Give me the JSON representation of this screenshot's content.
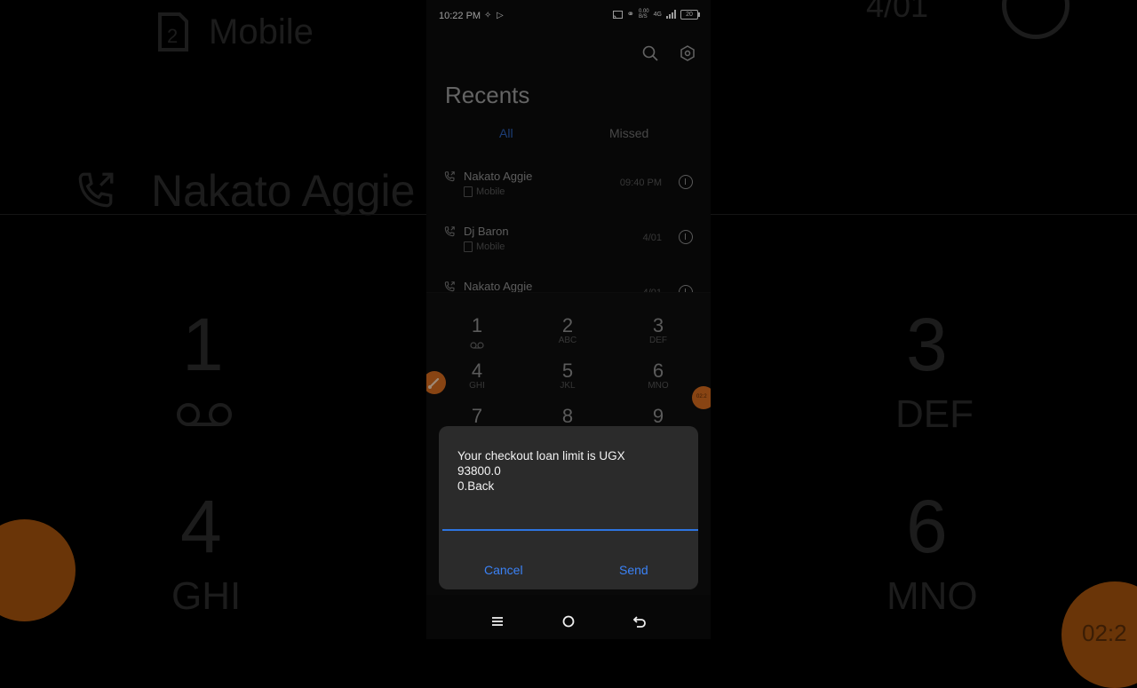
{
  "status_bar": {
    "time": "10:22 PM",
    "net_speed": "0.00",
    "net_unit": "B/S",
    "network": "4G",
    "battery": "20"
  },
  "app": {
    "title": "Recents"
  },
  "tabs": [
    {
      "label": "All",
      "active": true
    },
    {
      "label": "Missed",
      "active": false
    }
  ],
  "calls": [
    {
      "name": "Nakato Aggie",
      "line": "Mobile",
      "time": "09:40 PM"
    },
    {
      "name": "Dj Baron",
      "line": "Mobile",
      "time": "4/01"
    },
    {
      "name": "Nakato Aggie",
      "line": "",
      "time": "4/01"
    }
  ],
  "dialpad": [
    {
      "digit": "1",
      "letters": ""
    },
    {
      "digit": "2",
      "letters": "ABC"
    },
    {
      "digit": "3",
      "letters": "DEF"
    },
    {
      "digit": "4",
      "letters": "GHI"
    },
    {
      "digit": "5",
      "letters": "JKL"
    },
    {
      "digit": "6",
      "letters": "MNO"
    },
    {
      "digit": "7",
      "letters": ""
    },
    {
      "digit": "8",
      "letters": ""
    },
    {
      "digit": "9",
      "letters": ""
    }
  ],
  "dialog": {
    "message": "Your checkout loan limit is UGX\n93800.0\n0.Back",
    "input_value": "",
    "cancel_label": "Cancel",
    "send_label": "Send"
  },
  "background": {
    "sim_label": "Mobile",
    "name": "Nakato Aggie",
    "date": "4/01",
    "keys": [
      {
        "digit": "1",
        "letters": ""
      },
      {
        "digit": "3",
        "letters": "DEF"
      },
      {
        "digit": "4",
        "letters": "GHI"
      },
      {
        "digit": "6",
        "letters": "MNO"
      }
    ],
    "timer": "02:2"
  },
  "colors": {
    "accent": "#2d74e0",
    "tab_active": "#2c5fb5",
    "floating": "#d2691e",
    "dialog_bg": "#2b2b2b"
  },
  "icons": {
    "search": "search-icon",
    "settings": "settings-icon",
    "call": "outgoing-call-icon",
    "info": "info-icon",
    "voicemail": "voicemail-icon",
    "recents": "recents-icon",
    "home": "home-icon",
    "back": "back-icon"
  }
}
